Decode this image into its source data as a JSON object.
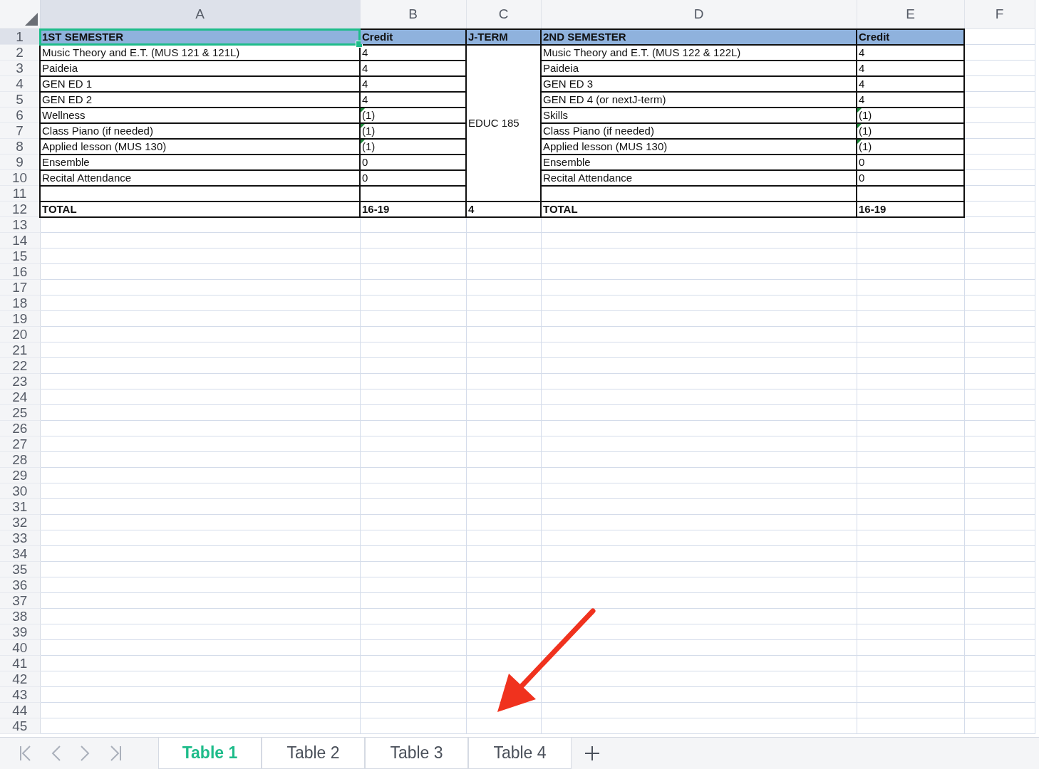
{
  "sheet": {
    "columns": [
      {
        "label": "A",
        "selected": true
      },
      {
        "label": "B",
        "selected": false
      },
      {
        "label": "C",
        "selected": false
      },
      {
        "label": "D",
        "selected": false
      },
      {
        "label": "E",
        "selected": false
      },
      {
        "label": "F",
        "selected": false
      }
    ],
    "j_term_merged": "EDUC 185",
    "rows": [
      {
        "number": "1",
        "selected": true,
        "kind": "header",
        "a": "1ST SEMESTER",
        "b": "Credit",
        "c": "J-TERM",
        "d": "2ND SEMESTER",
        "e": "Credit"
      },
      {
        "number": "2",
        "selected": false,
        "kind": "course",
        "a": "Music Theory and E.T. (MUS 121 & 121L)",
        "b": "4",
        "b_flag": false,
        "d": "Music Theory and E.T.  (MUS 122 & 122L)",
        "e": "4",
        "e_flag": false
      },
      {
        "number": "3",
        "selected": false,
        "kind": "course",
        "a": "Paideia",
        "b": "4",
        "b_flag": false,
        "d": "Paideia",
        "e": "4",
        "e_flag": false
      },
      {
        "number": "4",
        "selected": false,
        "kind": "course",
        "a": "GEN ED 1",
        "b": "4",
        "b_flag": false,
        "d": "GEN ED 3",
        "e": "4",
        "e_flag": false
      },
      {
        "number": "5",
        "selected": false,
        "kind": "course",
        "a": "GEN ED 2",
        "b": "4",
        "b_flag": false,
        "d": "GEN ED 4 (or nextJ-term)",
        "e": "4",
        "e_flag": false
      },
      {
        "number": "6",
        "selected": false,
        "kind": "course",
        "a": "Wellness",
        "b": "(1)",
        "b_flag": true,
        "d": "Skills",
        "e": "(1)",
        "e_flag": true
      },
      {
        "number": "7",
        "selected": false,
        "kind": "course",
        "a": "Class Piano (if needed)",
        "b": "(1)",
        "b_flag": true,
        "d": "Class Piano (if needed)",
        "e": "(1)",
        "e_flag": true
      },
      {
        "number": "8",
        "selected": false,
        "kind": "course",
        "a": "Applied lesson (MUS 130)",
        "b": "(1)",
        "b_flag": true,
        "d": "Applied lesson (MUS 130)",
        "e": "(1)",
        "e_flag": true
      },
      {
        "number": "9",
        "selected": false,
        "kind": "course",
        "a": "Ensemble",
        "b": "0",
        "b_flag": false,
        "d": "Ensemble",
        "e": "0",
        "e_flag": false
      },
      {
        "number": "10",
        "selected": false,
        "kind": "course",
        "a": "Recital Attendance",
        "b": "0",
        "b_flag": false,
        "d": "Recital Attendance",
        "e": "0",
        "e_flag": false
      },
      {
        "number": "11",
        "selected": false,
        "kind": "blank"
      },
      {
        "number": "12",
        "selected": false,
        "kind": "total",
        "a": "TOTAL",
        "b": "16-19",
        "c": "4",
        "d": "TOTAL",
        "e": "16-19"
      },
      {
        "number": "13",
        "selected": false,
        "kind": "empty"
      },
      {
        "number": "14",
        "selected": false,
        "kind": "empty"
      },
      {
        "number": "15",
        "selected": false,
        "kind": "empty"
      },
      {
        "number": "16",
        "selected": false,
        "kind": "empty"
      },
      {
        "number": "17",
        "selected": false,
        "kind": "empty"
      },
      {
        "number": "18",
        "selected": false,
        "kind": "empty"
      },
      {
        "number": "19",
        "selected": false,
        "kind": "empty"
      },
      {
        "number": "20",
        "selected": false,
        "kind": "empty"
      },
      {
        "number": "21",
        "selected": false,
        "kind": "empty"
      },
      {
        "number": "22",
        "selected": false,
        "kind": "empty"
      },
      {
        "number": "23",
        "selected": false,
        "kind": "empty"
      },
      {
        "number": "24",
        "selected": false,
        "kind": "empty"
      },
      {
        "number": "25",
        "selected": false,
        "kind": "empty"
      },
      {
        "number": "26",
        "selected": false,
        "kind": "empty"
      },
      {
        "number": "27",
        "selected": false,
        "kind": "empty"
      },
      {
        "number": "28",
        "selected": false,
        "kind": "empty"
      },
      {
        "number": "29",
        "selected": false,
        "kind": "empty"
      },
      {
        "number": "30",
        "selected": false,
        "kind": "empty"
      },
      {
        "number": "31",
        "selected": false,
        "kind": "empty"
      },
      {
        "number": "32",
        "selected": false,
        "kind": "empty"
      },
      {
        "number": "33",
        "selected": false,
        "kind": "empty"
      },
      {
        "number": "34",
        "selected": false,
        "kind": "empty"
      },
      {
        "number": "35",
        "selected": false,
        "kind": "empty"
      },
      {
        "number": "36",
        "selected": false,
        "kind": "empty"
      },
      {
        "number": "37",
        "selected": false,
        "kind": "empty"
      },
      {
        "number": "38",
        "selected": false,
        "kind": "empty"
      },
      {
        "number": "39",
        "selected": false,
        "kind": "empty"
      },
      {
        "number": "40",
        "selected": false,
        "kind": "empty"
      },
      {
        "number": "41",
        "selected": false,
        "kind": "empty"
      },
      {
        "number": "42",
        "selected": false,
        "kind": "empty"
      },
      {
        "number": "43",
        "selected": false,
        "kind": "empty"
      },
      {
        "number": "44",
        "selected": false,
        "kind": "empty"
      },
      {
        "number": "45",
        "selected": false,
        "kind": "empty"
      }
    ]
  },
  "tabs": [
    {
      "label": "Table 1",
      "selected": true
    },
    {
      "label": "Table 2",
      "selected": false
    },
    {
      "label": "Table 3",
      "selected": false
    },
    {
      "label": "Table 4",
      "selected": false
    }
  ]
}
